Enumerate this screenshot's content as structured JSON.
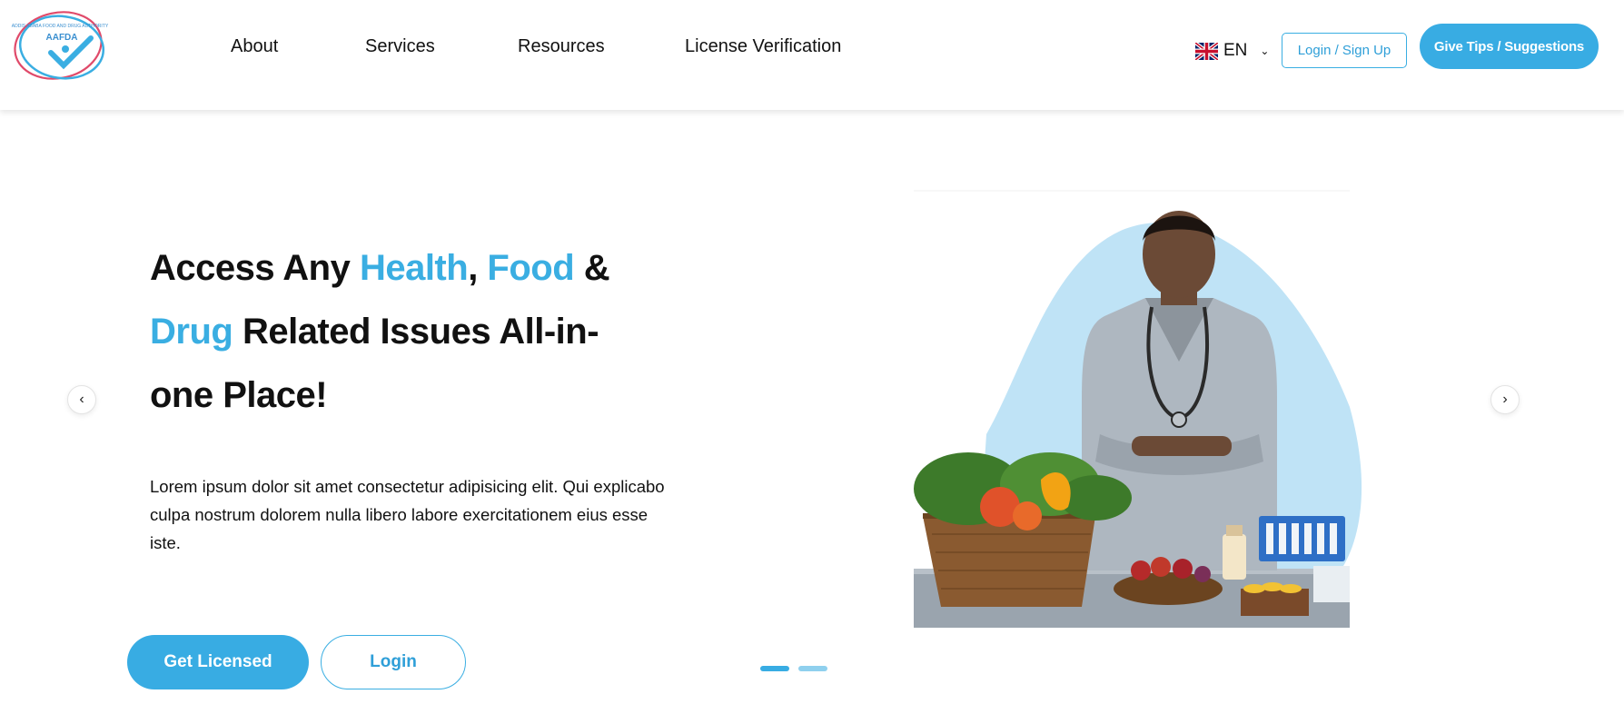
{
  "logo": {
    "name": "AAFDA",
    "tagline": "ADDIS ABABA FOOD AND DRUG AUTHORITY"
  },
  "nav": {
    "items": [
      {
        "label": "About"
      },
      {
        "label": "Services"
      },
      {
        "label": "Resources"
      },
      {
        "label": "License Verification"
      }
    ]
  },
  "language": {
    "code": "EN",
    "flag_icon": "uk-flag-icon"
  },
  "header_buttons": {
    "login_signup": "Login / Sign Up",
    "tips": "Give Tips / Suggestions"
  },
  "hero": {
    "title_part1": "Access Any ",
    "title_health": "Health",
    "title_comma": ", ",
    "title_food": "Food",
    "title_amp": " & ",
    "title_drug": "Drug",
    "title_part2": " Related Issues All-in-one Place!",
    "description": "Lorem ipsum dolor sit amet consectetur adipisicing elit. Qui explicabo culpa nostrum dolorem nulla libero labore exercitationem eius esse iste.",
    "btn_get_licensed": "Get Licensed",
    "btn_login": "Login"
  },
  "carousel": {
    "prev_icon": "chevron-left-icon",
    "next_icon": "chevron-right-icon",
    "slide_count": 2,
    "active_index": 0
  },
  "colors": {
    "accent": "#38ace3",
    "accent_light": "#bfe3f6",
    "text": "#111111"
  }
}
